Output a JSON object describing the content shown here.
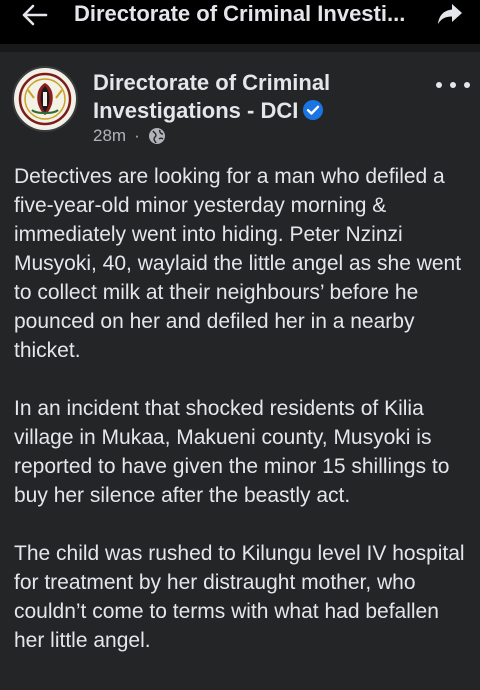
{
  "header": {
    "title": "Directorate of Criminal Investi...",
    "back_icon": "arrow-left-icon",
    "share_icon": "share-arrow-icon"
  },
  "post": {
    "page_name": "Directorate of Criminal Investigations - DCI",
    "verified_icon": "verified-badge-icon",
    "time": "28m",
    "separator": "·",
    "audience_icon": "globe-icon",
    "more_icon": "more-dots-icon",
    "paragraphs": [
      "Detectives are looking for a man who defiled a five-year-old minor yesterday morning & immediately went into hiding. Peter Nzinzi Musyoki, 40, waylaid the little angel as she went to collect milk at their neighbours’ before he pounced on her and defiled her in a nearby thicket.",
      "In an incident that shocked residents of Kilia village in Mukaa, Makueni county, Musyoki is reported to have given the minor 15 shillings to buy her silence after the beastly act.",
      "The child was rushed to Kilungu level IV hospital for treatment by her distraught mother, who couldn’t come to terms with what had befallen her little angel."
    ]
  },
  "colors": {
    "background": "#000000",
    "post_background": "#242526",
    "text_primary": "#e4e6eb",
    "text_secondary": "#b0b3b8",
    "verified_blue": "#1b74e4"
  }
}
